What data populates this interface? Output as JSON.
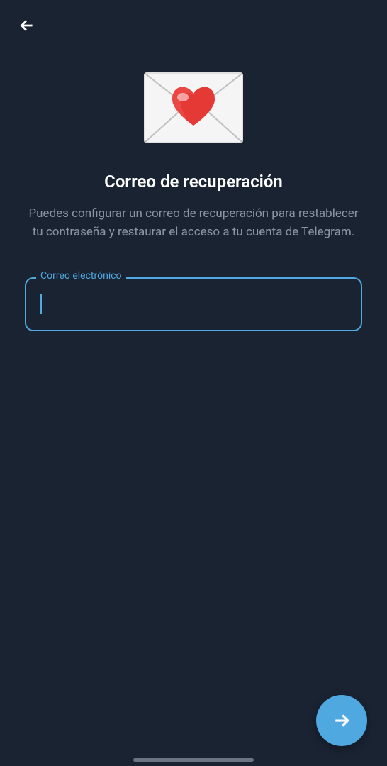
{
  "header": {
    "back_label": "Back"
  },
  "main": {
    "title": "Correo de recuperación",
    "description": "Puedes configurar un correo de recuperación para restablecer tu contraseña y restaurar el acceso a tu cuenta de Telegram.",
    "input_label": "Correo electrónico",
    "input_value": ""
  },
  "fab": {
    "label": "Next"
  }
}
